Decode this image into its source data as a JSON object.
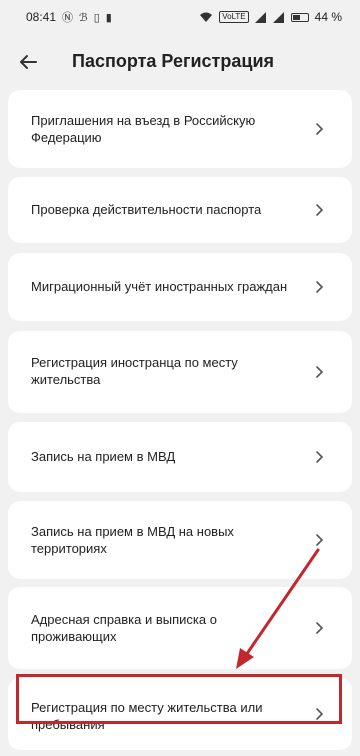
{
  "status_bar": {
    "time": "08:41",
    "left_icons": [
      "n-icon",
      "b-icon",
      "vibrate-icon",
      "card-icon"
    ],
    "network_badge": "VoLTE",
    "battery": "44 %"
  },
  "header": {
    "title": "Паспорта Регистрация"
  },
  "menu": {
    "items": [
      {
        "label": "Приглашения на въезд в Российскую Федерацию"
      },
      {
        "label": "Проверка действительности паспорта"
      },
      {
        "label": "Миграционный учёт иностранных граждан"
      },
      {
        "label": "Регистрация иностранца по месту жительства"
      },
      {
        "label": "Запись на прием в МВД"
      },
      {
        "label": "Запись на прием в МВД на новых территориях"
      },
      {
        "label": "Адресная справка и выписка о проживающих"
      },
      {
        "label": "Регистрация по месту жительства или пребывания"
      }
    ]
  },
  "annotation": {
    "color": "#c1272d"
  }
}
